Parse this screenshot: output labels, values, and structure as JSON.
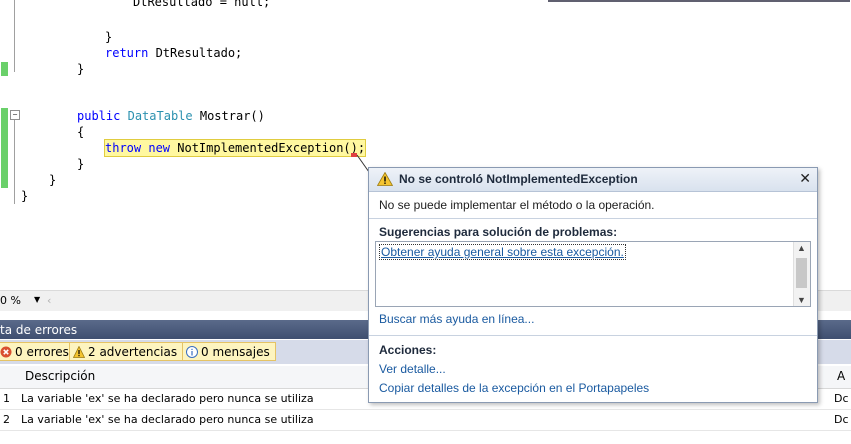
{
  "code": {
    "line_top_partial": "DtResultado = null;",
    "brace_close_inner": "}",
    "return_kw": "return",
    "return_rest": " DtResultado;",
    "brace_close_method": "}",
    "public_kw": "public",
    "type_name": "DataTable",
    "method_rest": " Mostrar()",
    "brace_open": "{",
    "throw_kw": "throw",
    "new_kw": " new",
    "throw_rest": " NotImplementedException();",
    "brace_close_method2": "}",
    "brace_close_class": "}",
    "brace_close_ns": "}"
  },
  "zoom": {
    "value": "0 %",
    "dropdown_icon": "chevron-down-icon"
  },
  "error_list": {
    "title": "ta de errores",
    "filters": [
      {
        "label": "0 errores",
        "icon": "error-icon"
      },
      {
        "label": "2 advertencias",
        "icon": "warning-icon"
      },
      {
        "label": "0 mensajes",
        "icon": "info-icon"
      }
    ],
    "columns": {
      "description": "Descripción",
      "last": "A"
    },
    "rows": [
      {
        "num": "1",
        "description": "La variable 'ex' se ha declarado pero nunca se utiliza",
        "last": "Dc"
      },
      {
        "num": "2",
        "description": "La variable 'ex' se ha declarado pero nunca se utiliza",
        "last": "Dc"
      }
    ]
  },
  "exception_popup": {
    "title": "No se controló NotImplementedException",
    "close": "✕",
    "message": "No se puede implementar el método o la operación.",
    "suggestions_label": "Sugerencias para solución de problemas:",
    "suggestions": [
      "Obtener ayuda general sobre esta excepción."
    ],
    "online_help": "Buscar más ayuda en línea...",
    "actions_label": "Acciones:",
    "actions": [
      "Ver detalle...",
      "Copiar detalles de la excepción en el Portapapeles"
    ]
  },
  "colors": {
    "keyword": "#0000ff",
    "type": "#2b91af",
    "highlight": "#fff8a0",
    "change_bar": "#6ad06a",
    "link": "#1a5aa0",
    "panel_title": "#4a5a7a"
  }
}
